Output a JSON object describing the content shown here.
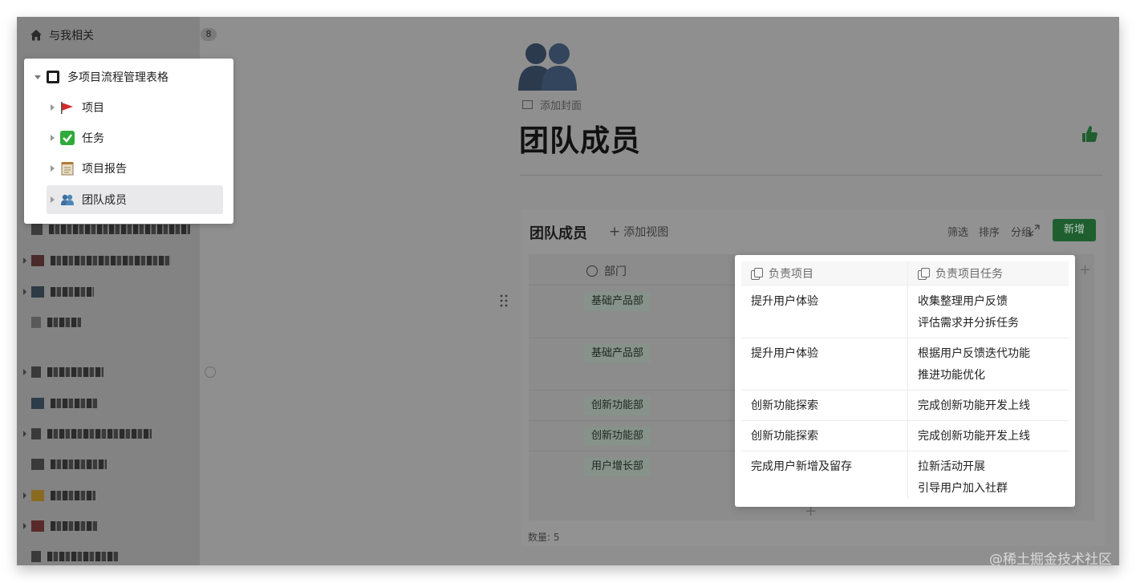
{
  "sidebar": {
    "top_label": "与我相关",
    "badge": "8",
    "tree": {
      "root_label": "多项目流程管理表格",
      "children": [
        {
          "label": "项目",
          "icon": "red-flag-icon"
        },
        {
          "label": "任务",
          "icon": "check-mark-icon"
        },
        {
          "label": "项目报告",
          "icon": "notepad-icon"
        },
        {
          "label": "团队成员",
          "icon": "people-icon"
        }
      ]
    }
  },
  "page": {
    "add_cover": "添加封面",
    "title": "团队成员"
  },
  "database": {
    "title": "团队成员",
    "add_view": "添加视图",
    "filter": "筛选",
    "sort": "排序",
    "group": "分组",
    "new_button": "新增",
    "column_dept": "部门",
    "departments": [
      "基础产品部",
      "基础产品部",
      "创新功能部",
      "创新功能部",
      "用户增长部"
    ],
    "count_label": "数量: 5"
  },
  "relation_panel": {
    "col1_header": "负责项目",
    "col2_header": "负责项目任务",
    "rows": [
      {
        "project": "提升用户体验",
        "tasks": [
          "收集整理用户反馈",
          "评估需求并分拆任务"
        ]
      },
      {
        "project": "提升用户体验",
        "tasks": [
          "根据用户反馈迭代功能",
          "推进功能优化"
        ]
      },
      {
        "project": "创新功能探索",
        "tasks": [
          "完成创新功能开发上线"
        ]
      },
      {
        "project": "创新功能探索",
        "tasks": [
          "完成创新功能开发上线"
        ]
      },
      {
        "project": "完成用户新增及留存",
        "tasks": [
          "拉新活动开展",
          "引导用户加入社群"
        ]
      }
    ]
  },
  "colors": {
    "accent_green": "#1f5f2f",
    "overlay_gray": "#8f8f8f"
  },
  "watermark": "@稀土掘金技术社区"
}
